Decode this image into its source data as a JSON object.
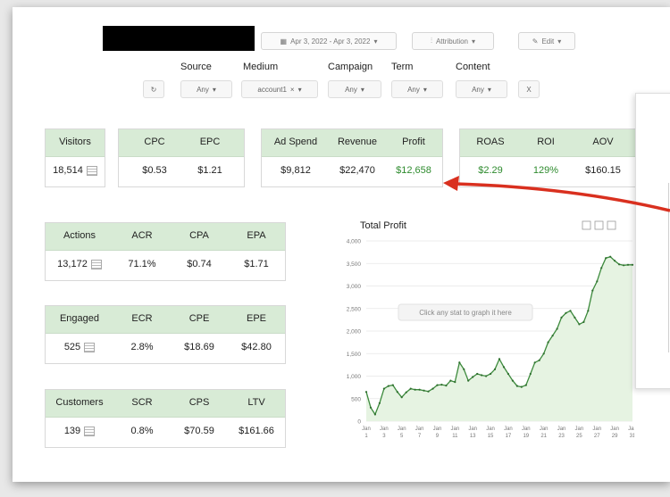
{
  "toolbar": {
    "date_range": "Apr 3, 2022 - Apr 3, 2022",
    "attribution": "Attribution",
    "edit": "Edit"
  },
  "filters": {
    "labels": [
      "Source",
      "Medium",
      "Campaign",
      "Term",
      "Content"
    ],
    "values": [
      "Any",
      "account1",
      "Any",
      "Any",
      "Any"
    ],
    "clear": "X"
  },
  "stats": {
    "visitors": {
      "label": "Visitors",
      "value": "18,514"
    },
    "cpc": {
      "label": "CPC",
      "value": "$0.53"
    },
    "epc": {
      "label": "EPC",
      "value": "$1.21"
    },
    "ad_spend": {
      "label": "Ad Spend",
      "value": "$9,812"
    },
    "revenue": {
      "label": "Revenue",
      "value": "$22,470"
    },
    "profit": {
      "label": "Profit",
      "value": "$12,658"
    },
    "roas": {
      "label": "ROAS",
      "value": "$2.29"
    },
    "roi": {
      "label": "ROI",
      "value": "129%"
    },
    "aov": {
      "label": "AOV",
      "value": "$160.15"
    },
    "actions": {
      "label": "Actions",
      "value": "13,172"
    },
    "acr": {
      "label": "ACR",
      "value": "71.1%"
    },
    "cpa": {
      "label": "CPA",
      "value": "$0.74"
    },
    "epa": {
      "label": "EPA",
      "value": "$1.71"
    },
    "engaged": {
      "label": "Engaged",
      "value": "525"
    },
    "ecr": {
      "label": "ECR",
      "value": "2.8%"
    },
    "cpe": {
      "label": "CPE",
      "value": "$18.69"
    },
    "epe": {
      "label": "EPE",
      "value": "$42.80"
    },
    "customers": {
      "label": "Customers",
      "value": "139"
    },
    "scr": {
      "label": "SCR",
      "value": "0.8%"
    },
    "cps": {
      "label": "CPS",
      "value": "$70.59"
    },
    "ltv": {
      "label": "LTV",
      "value": "$161.66"
    }
  },
  "colors": {
    "accent": "#2e8b2e",
    "header_bg": "#d8ebd6",
    "arrow": "#d9301f",
    "line": "#3c8a3c",
    "fill": "#e6f3e2"
  },
  "icons": [
    "calendar-icon",
    "chevron-down-icon",
    "bar-chart-icon",
    "pencil-icon",
    "refresh-icon",
    "list-icon"
  ],
  "chart_data": {
    "type": "area",
    "title": "Total Profit",
    "hint": "Click any stat to graph it here",
    "y_ticks": [
      "4,000",
      "3,500",
      "3,000",
      "2,500",
      "2,000",
      "1,500",
      "1,000",
      "500",
      "0"
    ],
    "x_ticks": [
      {
        "m": "Jan",
        "d": "1"
      },
      {
        "m": "Jan",
        "d": "3"
      },
      {
        "m": "Jan",
        "d": "5"
      },
      {
        "m": "Jan",
        "d": "7"
      },
      {
        "m": "Jan",
        "d": "9"
      },
      {
        "m": "Jan",
        "d": "11"
      },
      {
        "m": "Jan",
        "d": "13"
      },
      {
        "m": "Jan",
        "d": "15"
      },
      {
        "m": "Jan",
        "d": "17"
      },
      {
        "m": "Jan",
        "d": "19"
      },
      {
        "m": "Jan",
        "d": "21"
      },
      {
        "m": "Jan",
        "d": "23"
      },
      {
        "m": "Jan",
        "d": "25"
      },
      {
        "m": "Jan",
        "d": "27"
      },
      {
        "m": "Jan",
        "d": "29"
      },
      {
        "m": "Jan",
        "d": "31"
      }
    ],
    "ylim": [
      0,
      4000
    ],
    "x": [
      1,
      1.5,
      2,
      2.5,
      3,
      3.5,
      4,
      4.5,
      5,
      5.5,
      6,
      6.5,
      7,
      7.5,
      8,
      8.5,
      9,
      9.5,
      10,
      10.5,
      11,
      11.5,
      12,
      12.5,
      13,
      13.5,
      14,
      14.5,
      15,
      15.5,
      16,
      16.5,
      17,
      17.5,
      18,
      18.5,
      19,
      19.5,
      20,
      20.5,
      21,
      21.5,
      22,
      22.5,
      23,
      23.5,
      24,
      24.5,
      25,
      25.5,
      26,
      26.5,
      27,
      27.5,
      28,
      28.5,
      29,
      29.5,
      30,
      30.5,
      31
    ],
    "values": [
      650,
      300,
      150,
      400,
      720,
      780,
      800,
      650,
      530,
      640,
      720,
      700,
      700,
      680,
      660,
      720,
      800,
      810,
      790,
      900,
      870,
      1300,
      1150,
      900,
      980,
      1050,
      1020,
      1000,
      1050,
      1150,
      1380,
      1200,
      1050,
      900,
      780,
      760,
      800,
      1050,
      1300,
      1350,
      1500,
      1750,
      1900,
      2050,
      2300,
      2400,
      2450,
      2300,
      2150,
      2200,
      2450,
      2900,
      3100,
      3400,
      3620,
      3650,
      3560,
      3480,
      3460,
      3470,
      3470
    ]
  }
}
